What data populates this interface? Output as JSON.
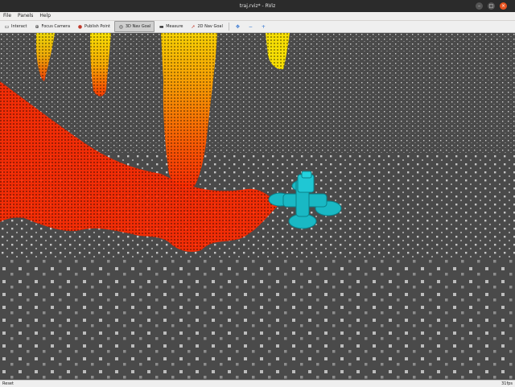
{
  "window": {
    "title": "traj.rviz* - RViz"
  },
  "menu": [
    "File",
    "Panels",
    "Help"
  ],
  "toolbar": {
    "interact": "Interact",
    "focus_camera": "Focus Camera",
    "publish_point": "Publish Point",
    "nav_goal_3d": "3D Nav Goal",
    "measure": "Measure",
    "nav_goal_2d": "2D Nav Goal",
    "add_symbol": "+",
    "remove_symbol": "−",
    "cursor_icon": "pointer-icon"
  },
  "status": {
    "left": "Reset",
    "right": "31fps"
  },
  "colors": {
    "drone": "#19b8c4",
    "cloud_red": "#ff2a00",
    "cloud_yellow": "#ffd800",
    "ground": "#4a4a4a"
  }
}
